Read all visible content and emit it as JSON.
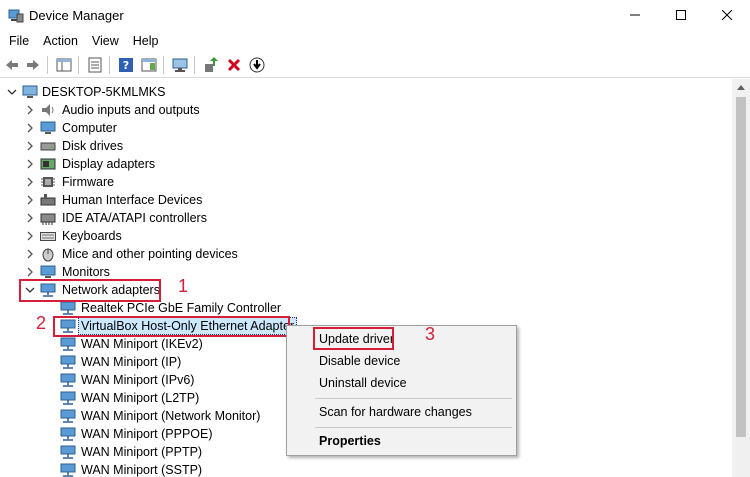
{
  "window": {
    "title": "Device Manager"
  },
  "menu": [
    "File",
    "Action",
    "View",
    "Help"
  ],
  "tree": {
    "root": "DESKTOP-5KMLMKS",
    "categories": [
      {
        "label": "Audio inputs and outputs",
        "icon": "speaker-icon"
      },
      {
        "label": "Computer",
        "icon": "computer-icon"
      },
      {
        "label": "Disk drives",
        "icon": "disk-drive-icon"
      },
      {
        "label": "Display adapters",
        "icon": "display-adapter-icon"
      },
      {
        "label": "Firmware",
        "icon": "firmware-icon"
      },
      {
        "label": "Human Interface Devices",
        "icon": "hid-icon"
      },
      {
        "label": "IDE ATA/ATAPI controllers",
        "icon": "ide-controller-icon"
      },
      {
        "label": "Keyboards",
        "icon": "keyboard-icon"
      },
      {
        "label": "Mice and other pointing devices",
        "icon": "mouse-icon"
      },
      {
        "label": "Monitors",
        "icon": "monitor-icon"
      }
    ],
    "network": {
      "label": "Network adapters",
      "children": [
        "Realtek PCIe GbE Family Controller",
        "VirtualBox Host-Only Ethernet Adapter",
        "WAN Miniport (IKEv2)",
        "WAN Miniport (IP)",
        "WAN Miniport (IPv6)",
        "WAN Miniport (L2TP)",
        "WAN Miniport (Network Monitor)",
        "WAN Miniport (PPPOE)",
        "WAN Miniport (PPTP)",
        "WAN Miniport (SSTP)"
      ]
    }
  },
  "context_menu": {
    "update": "Update driver",
    "disable": "Disable device",
    "uninstall": "Uninstall device",
    "scan": "Scan for hardware changes",
    "properties": "Properties"
  },
  "annotations": {
    "step1": "1",
    "step2": "2",
    "step3": "3"
  },
  "colors": {
    "highlight": "#d41e3a",
    "selection": "#cce8ff",
    "menu_bg": "#f2f2f2"
  }
}
